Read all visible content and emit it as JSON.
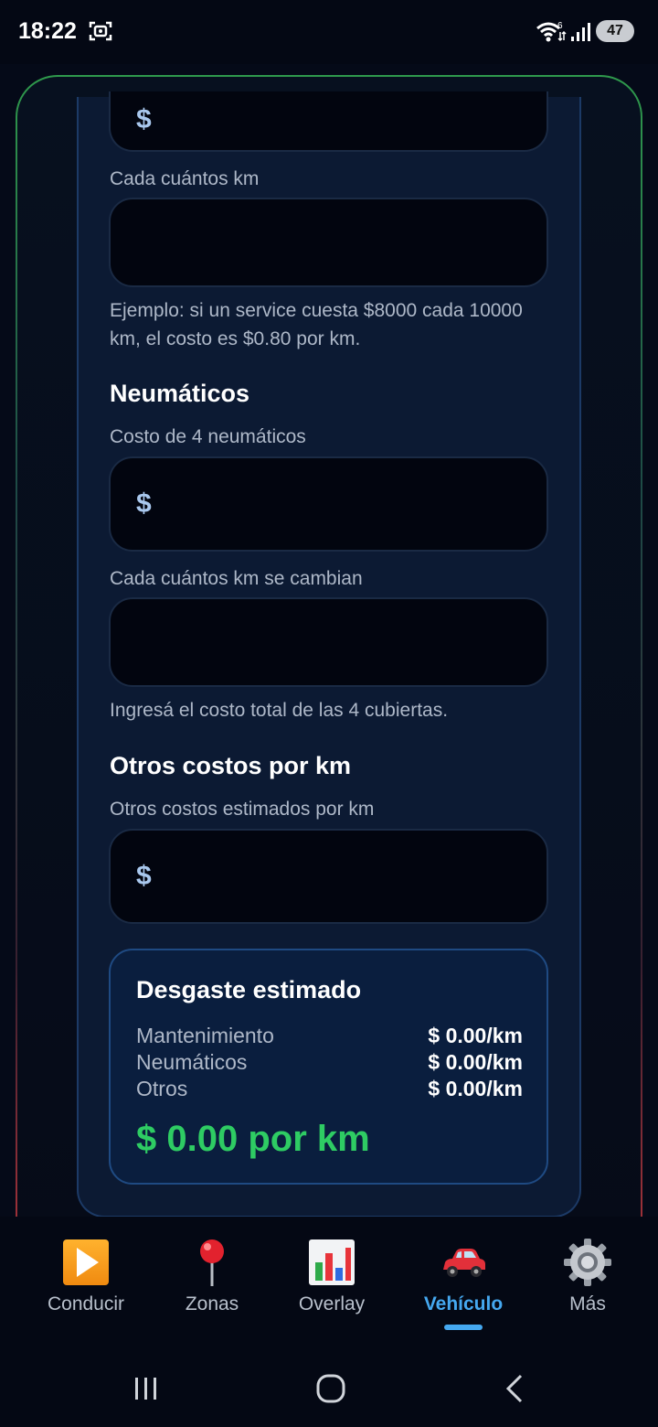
{
  "status_bar": {
    "time": "18:22",
    "wifi_badge": "6",
    "battery": "47"
  },
  "form": {
    "partial_field_prefix": "$",
    "service_km_label": "Cada cuántos km",
    "service_help": "Ejemplo: si un service cuesta $8000 cada 10000 km, el costo es $0.80 por km.",
    "tires_heading": "Neumáticos",
    "tires_cost_label": "Costo de 4 neumáticos",
    "tires_cost_prefix": "$",
    "tires_km_label": "Cada cuántos km se cambian",
    "tires_help": "Ingresá el costo total de las 4 cubiertas.",
    "other_heading": "Otros costos por km",
    "other_label": "Otros costos estimados por km",
    "other_prefix": "$"
  },
  "summary": {
    "title": "Desgaste estimado",
    "rows": [
      {
        "label": "Mantenimiento",
        "value": "$ 0.00/km"
      },
      {
        "label": "Neumáticos",
        "value": "$ 0.00/km"
      },
      {
        "label": "Otros",
        "value": "$ 0.00/km"
      }
    ],
    "total": "$ 0.00 por km"
  },
  "bottom_nav": {
    "items": [
      {
        "label": "Conducir",
        "icon": "play-button-icon"
      },
      {
        "label": "Zonas",
        "icon": "map-pin-icon"
      },
      {
        "label": "Overlay",
        "icon": "bar-chart-icon"
      },
      {
        "label": "Vehículo",
        "icon": "car-icon",
        "active": true
      },
      {
        "label": "Más",
        "icon": "gear-icon"
      }
    ]
  },
  "colors": {
    "accent": "#45a8f0",
    "total_green": "#2ecc63",
    "card_bg": "#0c1a33",
    "field_bg": "#02050f"
  }
}
